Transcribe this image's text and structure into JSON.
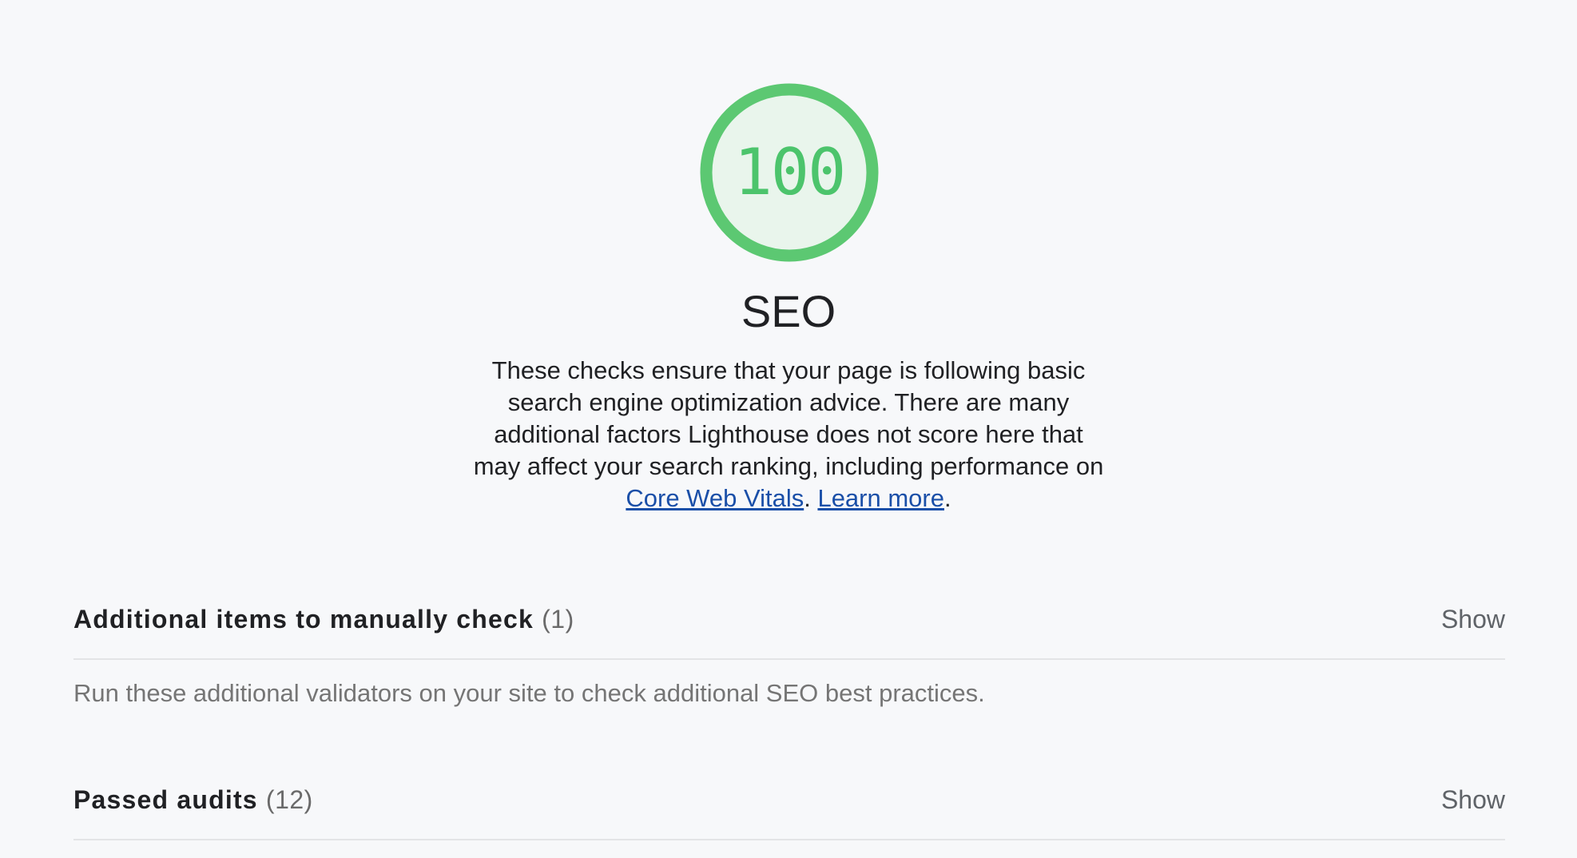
{
  "gauge": {
    "score": "100",
    "score_fraction": 1.0,
    "color": "#5cc872",
    "fill_color": "#e9f5ec"
  },
  "category": {
    "title": "SEO",
    "description_text": "These checks ensure that your page is following basic search engine optimization advice. There are many additional factors Lighthouse does not score here that may affect your search ranking, including performance on ",
    "link_core_web_vitals": "Core Web Vitals",
    "separator": ". ",
    "link_learn_more": "Learn more",
    "end": "."
  },
  "groups": {
    "manual": {
      "title": "Additional items to manually check",
      "count": "(1)",
      "show_label": "Show",
      "description": "Run these additional validators on your site to check additional SEO best practices."
    },
    "passed": {
      "title": "Passed audits",
      "count": "(12)",
      "show_label": "Show"
    }
  },
  "colors": {
    "background": "#f7f8fa",
    "pass_green": "#5cc872",
    "link_blue": "#1a4fa8"
  }
}
